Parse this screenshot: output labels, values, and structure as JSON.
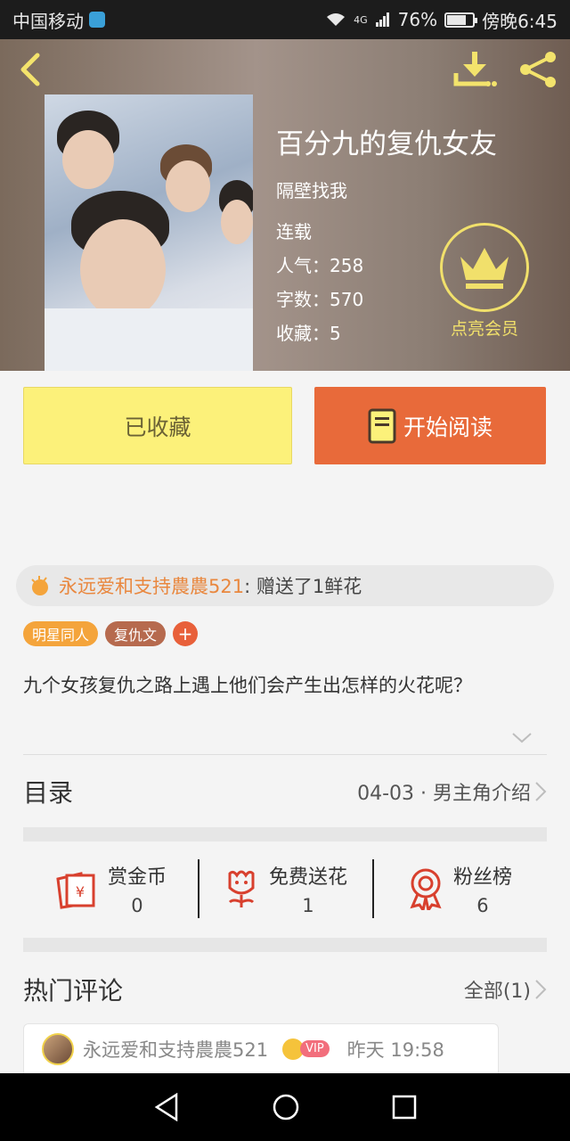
{
  "status": {
    "carrier": "中国移动",
    "network": "4G",
    "battery": "76%",
    "time": "傍晚6:45",
    "battery_level": 0.76
  },
  "book": {
    "title": "百分九的复仇女友",
    "author": "隔壁找我",
    "status": "连载",
    "popularity": "人气：258",
    "word_count": "字数：570",
    "favorites": "收藏：5"
  },
  "vip": {
    "label": "点亮会员"
  },
  "actions": {
    "favorited": "已收藏",
    "read": "开始阅读"
  },
  "gift": {
    "user": "永远爱和支持農農521",
    "message": ": 赠送了1鲜花"
  },
  "tags": [
    {
      "label": "明星同人",
      "color": "#f4a43b"
    },
    {
      "label": "复仇文",
      "color": "#b66a4e"
    },
    {
      "label": "+",
      "color": "#e8603a"
    }
  ],
  "description": "九个女孩复仇之路上遇上他们会产生出怎样的火花呢？",
  "toc": {
    "title": "目录",
    "latest": "04-03 · 男主角介绍"
  },
  "stats": [
    {
      "label": "赏金币",
      "value": "0",
      "icon": "reward-coin-icon"
    },
    {
      "label": "免费送花",
      "value": "1",
      "icon": "flower-icon"
    },
    {
      "label": "粉丝榜",
      "value": "6",
      "icon": "medal-icon"
    }
  ],
  "comments": {
    "title": "热门评论",
    "all": "全部(1)",
    "first": {
      "user": "永远爱和支持農農521",
      "badge": "VIP",
      "time": "昨天 19:58"
    }
  },
  "colors": {
    "accent_orange": "#e86a3a",
    "fav_yellow": "#fcf17a",
    "vip_gold": "#f1e06b"
  }
}
